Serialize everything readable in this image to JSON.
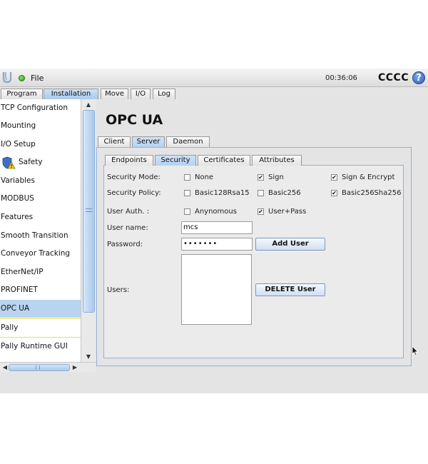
{
  "topbar": {
    "file_label": "File",
    "clock": "00:36:06",
    "robot_name": "CCCC",
    "help_label": "?"
  },
  "main_tabs": [
    {
      "label": "Program",
      "active": false
    },
    {
      "label": "Installation",
      "active": true
    },
    {
      "label": "Move",
      "active": false
    },
    {
      "label": "I/O",
      "active": false
    },
    {
      "label": "Log",
      "active": false
    }
  ],
  "sidebar": {
    "items": [
      {
        "label": "TCP Configuration"
      },
      {
        "label": "Mounting"
      },
      {
        "label": "I/O Setup"
      },
      {
        "label": "Safety",
        "icon": "warning-shield-icon"
      },
      {
        "label": "Variables"
      },
      {
        "label": "MODBUS"
      },
      {
        "label": "Features"
      },
      {
        "label": "Smooth Transition"
      },
      {
        "label": "Conveyor Tracking"
      },
      {
        "label": "EtherNet/IP"
      },
      {
        "label": "PROFINET"
      },
      {
        "label": "OPC UA",
        "selected": true
      },
      {
        "label": "Pally"
      },
      {
        "label": "Pally Runtime GUI"
      }
    ]
  },
  "page": {
    "title": "OPC UA",
    "tabs": [
      {
        "label": "Client",
        "active": false
      },
      {
        "label": "Server",
        "active": true
      },
      {
        "label": "Daemon",
        "active": false
      }
    ],
    "subtabs": [
      {
        "label": "Endpoints",
        "active": false
      },
      {
        "label": "Security",
        "active": true
      },
      {
        "label": "Certificates",
        "active": false
      },
      {
        "label": "Attributes",
        "active": false
      }
    ]
  },
  "security": {
    "mode_label": "Security Mode:",
    "mode_options": [
      {
        "label": "None",
        "checked": false
      },
      {
        "label": "Sign",
        "checked": true
      },
      {
        "label": "Sign & Encrypt",
        "checked": true
      }
    ],
    "policy_label": "Security Policy:",
    "policy_options": [
      {
        "label": "Basic128Rsa15",
        "checked": false
      },
      {
        "label": "Basic256",
        "checked": false
      },
      {
        "label": "Basic256Sha256",
        "checked": true
      }
    ],
    "auth_label": "User Auth. :",
    "auth_options": [
      {
        "label": "Anynomous",
        "checked": false
      },
      {
        "label": "User+Pass",
        "checked": true
      }
    ],
    "username_label": "User name:",
    "username_value": "mcs",
    "password_label": "Password:",
    "password_value": "•••••••",
    "users_label": "Users:",
    "add_user_label": "Add User",
    "delete_user_label": "DELETE User",
    "check_mark": "✔"
  }
}
